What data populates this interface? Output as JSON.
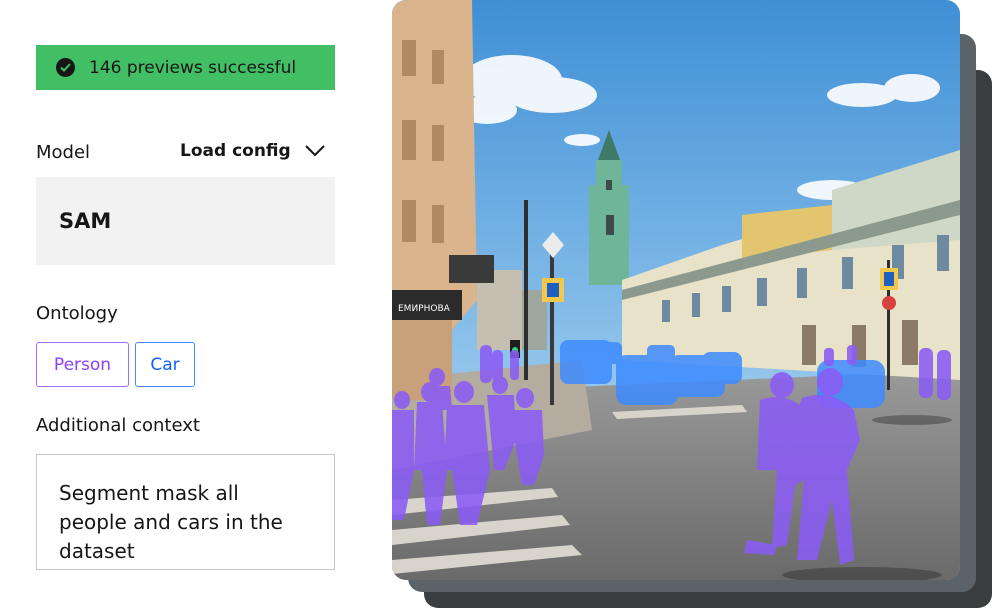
{
  "toast": {
    "icon": "checkmark-filled-icon",
    "text": "146 previews successful",
    "color": "#42be65"
  },
  "model": {
    "label": "Model",
    "load_config_label": "Load config",
    "load_config_icon": "chevron-down-icon",
    "value": "SAM"
  },
  "ontology": {
    "label": "Ontology",
    "tags": [
      {
        "label": "Person",
        "color": "#a56eff"
      },
      {
        "label": "Car",
        "color": "#4589ff"
      }
    ]
  },
  "context": {
    "label": "Additional context",
    "value": "Segment mask all people and cars in the dataset"
  },
  "preview": {
    "sign_text": "ЕМИРНОВА",
    "person_mask_color": "#8a5cf5",
    "car_mask_color": "#3d8bff"
  }
}
